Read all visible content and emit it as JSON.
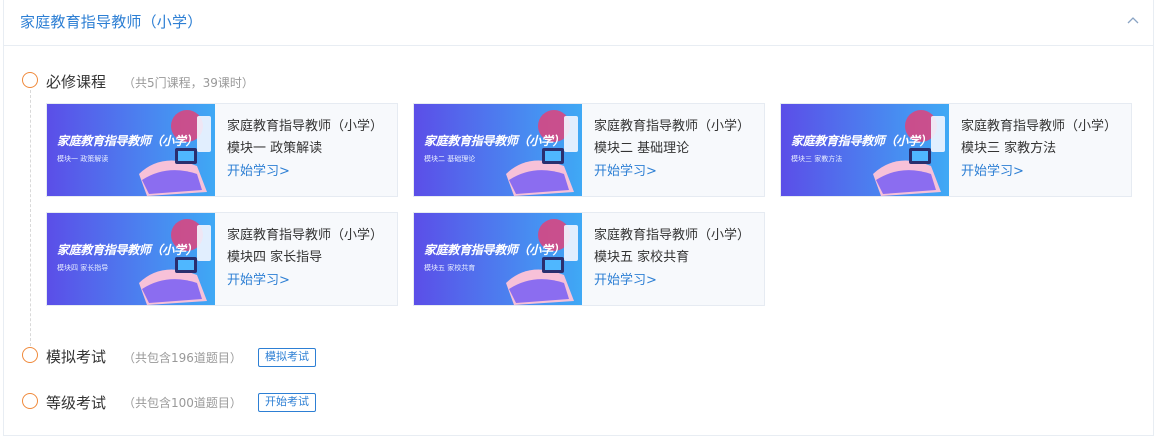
{
  "header": {
    "title": "家庭教育指导教师（小学）"
  },
  "required": {
    "title": "必修课程",
    "note": "（共5门课程，39课时）",
    "courses": [
      {
        "name": "家庭教育指导教师（小学）模块一 政策解读",
        "link": "开始学习>",
        "thumb_title": "家庭教育指导教师（小学）",
        "thumb_sub": "模块一  政策解读"
      },
      {
        "name": "家庭教育指导教师（小学）模块二 基础理论",
        "link": "开始学习>",
        "thumb_title": "家庭教育指导教师（小学）",
        "thumb_sub": "模块二  基础理论"
      },
      {
        "name": "家庭教育指导教师（小学）模块三 家教方法",
        "link": "开始学习>",
        "thumb_title": "家庭教育指导教师（小学）",
        "thumb_sub": "模块三  家教方法"
      },
      {
        "name": "家庭教育指导教师（小学）模块四 家长指导",
        "link": "开始学习>",
        "thumb_title": "家庭教育指导教师（小学）",
        "thumb_sub": "模块四  家长指导"
      },
      {
        "name": "家庭教育指导教师（小学）模块五 家校共育",
        "link": "开始学习>",
        "thumb_title": "家庭教育指导教师（小学）",
        "thumb_sub": "模块五  家校共育"
      }
    ]
  },
  "mock_exam": {
    "title": "模拟考试",
    "note": "（共包含196道题目）",
    "button": "模拟考试"
  },
  "grade_exam": {
    "title": "等级考试",
    "note": "（共包含100道题目）",
    "button": "开始考试"
  },
  "colors": {
    "accent": "#2d7fd4",
    "timeline_circle": "#f08a3c",
    "thumb_gradient_start": "#5b4ee8",
    "thumb_gradient_end": "#3fa9f5"
  }
}
